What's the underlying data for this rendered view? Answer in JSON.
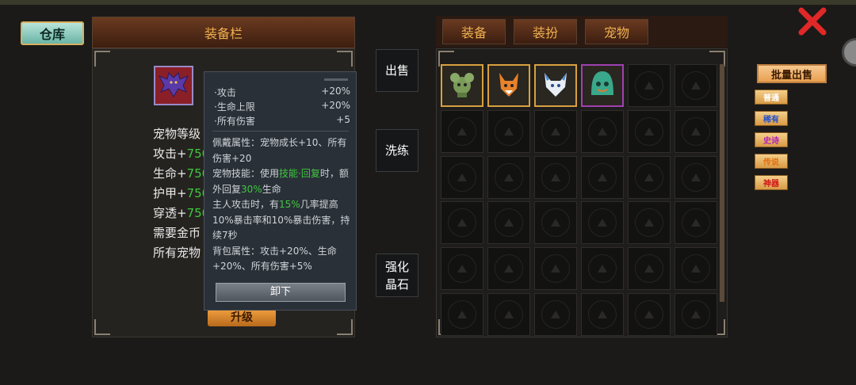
{
  "warehouse_label": "仓库",
  "left_panel": {
    "title": "装备栏",
    "stats": [
      {
        "label": "宠物等级",
        "value": ""
      },
      {
        "label": "攻击+",
        "value": "750"
      },
      {
        "label": "生命+",
        "value": "750"
      },
      {
        "label": "护甲+",
        "value": "750"
      },
      {
        "label": "穿透+",
        "value": "750"
      },
      {
        "label": "需要金币",
        "value": ""
      },
      {
        "label": "所有宠物",
        "value": ""
      }
    ],
    "upgrade_label": "升级"
  },
  "tooltip": {
    "stats": [
      {
        "name": "·攻击",
        "value": "+20%"
      },
      {
        "name": "·生命上限",
        "value": "+20%"
      },
      {
        "name": "·所有伤害",
        "value": "+5"
      }
    ],
    "wear_attr": "佩戴属性：宠物成长+10、所有伤害+20",
    "skill_prefix": "宠物技能：使用",
    "skill_hl1": "技能·回复",
    "skill_mid": "时，额外回复",
    "skill_hl2": "30%",
    "skill_suffix": "生命",
    "attack_prefix": "主人攻击时，有",
    "attack_hl": "15%",
    "attack_suffix": "几率提高10%暴击率和10%暴击伤害，持续7秒",
    "bag_attr": "背包属性：攻击+20%、生命+20%、所有伤害+5%",
    "unequip_label": "卸下"
  },
  "middle_buttons": {
    "sell": "出售",
    "refine": "洗练",
    "enhance_line1": "强化",
    "enhance_line2": "晶石"
  },
  "tabs": [
    "装备",
    "装扮",
    "宠物"
  ],
  "pets": [
    {
      "name": "green-mouse-pet",
      "border": "#d8a040"
    },
    {
      "name": "orange-fox-pet",
      "border": "#d8a040"
    },
    {
      "name": "white-blue-cat-pet",
      "border": "#d8a040"
    },
    {
      "name": "green-ghost-pet",
      "border": "#a040b0"
    }
  ],
  "bulk_sell_label": "批量出售",
  "filters": [
    {
      "label": "普通",
      "color": "#ffffff"
    },
    {
      "label": "稀有",
      "color": "#2050d0"
    },
    {
      "label": "史诗",
      "color": "#b020c0"
    },
    {
      "label": "传说",
      "color": "#e07010"
    },
    {
      "label": "神器",
      "color": "#d01818"
    }
  ],
  "colors": {
    "accent": "#f0b050",
    "highlight": "#3ec83e",
    "close": "#e02828"
  }
}
